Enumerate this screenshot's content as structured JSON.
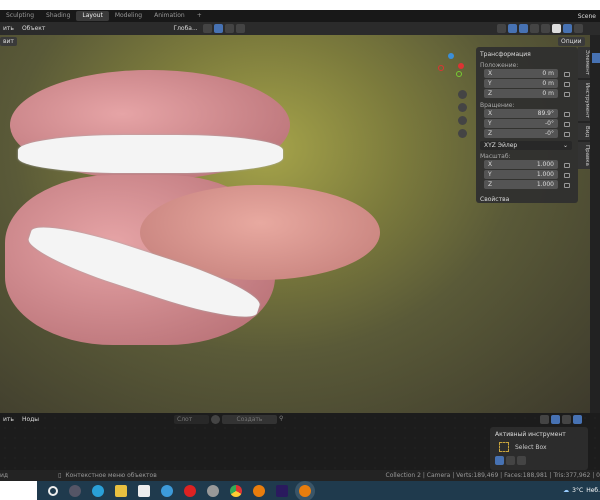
{
  "tabs": [
    "Sculpting",
    "Shading",
    "Layout",
    "Modeling",
    "Animation",
    "+"
  ],
  "active_tab": "Layout",
  "scene": "Scene",
  "header": {
    "menu": [
      "ить",
      "Объект"
    ],
    "orientation": "Глоба...",
    "mode": "вит",
    "options": "Опции"
  },
  "properties": {
    "title": "Трансформация",
    "location_label": "Положение:",
    "location": [
      {
        "axis": "X",
        "value": "0 m"
      },
      {
        "axis": "Y",
        "value": "0 m"
      },
      {
        "axis": "Z",
        "value": "0 m"
      }
    ],
    "rotation_label": "Вращение:",
    "rotation": [
      {
        "axis": "X",
        "value": "89.9°"
      },
      {
        "axis": "Y",
        "value": "-0°"
      },
      {
        "axis": "Z",
        "value": "-0°"
      }
    ],
    "rotation_mode": "XYZ Эйлер",
    "scale_label": "Масштаб:",
    "scale": [
      {
        "axis": "X",
        "value": "1.000"
      },
      {
        "axis": "Y",
        "value": "1.000"
      },
      {
        "axis": "Z",
        "value": "1.000"
      }
    ],
    "properties_section": "Свойства"
  },
  "side_tabs": [
    "Элемент",
    "Инструмент",
    "Вид",
    "Правка"
  ],
  "node_editor": {
    "menu": [
      "ить",
      "Ноды"
    ],
    "slot": "Слот",
    "new_button": "Создать"
  },
  "active_tool": {
    "title": "Активный инструмент",
    "tool": "Select Box"
  },
  "status": {
    "left": "ид",
    "context": "Контекстное меню объектов",
    "stats": "Collection 2 | Camera | Verts:189,469 | Faces:188,981 | Tris:377,962 | 0"
  },
  "taskbar": {
    "weather": "3°C",
    "weather_text": "Неб."
  }
}
